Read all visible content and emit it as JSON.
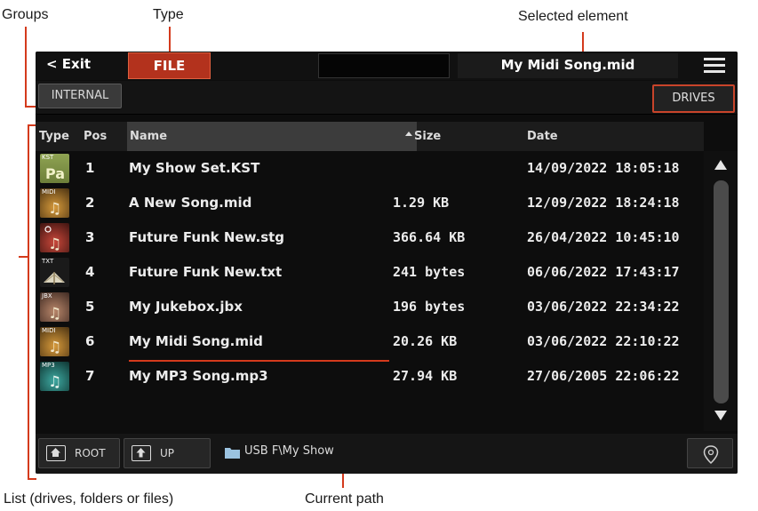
{
  "callouts": {
    "groups": "Groups",
    "type": "Type",
    "selected_element": "Selected element",
    "list": "List (drives, folders or files)",
    "current_path": "Current path"
  },
  "topbar": {
    "exit_label": "< Exit",
    "type_label": "FILE",
    "selected_element": "My Midi Song.mid",
    "menu_icon": "hamburger-icon"
  },
  "groups": {
    "internal_label": "INTERNAL",
    "drives_label": "DRIVES"
  },
  "table": {
    "headers": {
      "type": "Type",
      "pos": "Pos",
      "name": "Name",
      "size": "Size",
      "date": "Date"
    },
    "sort_column": "Name",
    "rows": [
      {
        "icon": "pa-set-icon",
        "icon_tag": "KST",
        "pos": "1",
        "name": "My Show Set.KST",
        "size": "",
        "date": "14/09/2022 18:05:18"
      },
      {
        "icon": "midi-file-icon",
        "icon_tag": "MIDI",
        "pos": "2",
        "name": "A New Song.mid",
        "size": "1.29 KB",
        "date": "12/09/2022 18:24:18"
      },
      {
        "icon": "style-file-icon",
        "icon_tag": "",
        "pos": "3",
        "name": "Future Funk New.stg",
        "size": "366.64 KB",
        "date": "26/04/2022 10:45:10"
      },
      {
        "icon": "txt-file-icon",
        "icon_tag": "TXT",
        "pos": "4",
        "name": "Future Funk New.txt",
        "size": "241 bytes",
        "date": "06/06/2022 17:43:17"
      },
      {
        "icon": "jukebox-file-icon",
        "icon_tag": "JBX",
        "pos": "5",
        "name": "My Jukebox.jbx",
        "size": "196 bytes",
        "date": "03/06/2022 22:34:22"
      },
      {
        "icon": "midi-file-icon",
        "icon_tag": "MIDI",
        "pos": "6",
        "name": "My Midi Song.mid",
        "size": "20.26 KB",
        "date": "03/06/2022 22:10:22"
      },
      {
        "icon": "mp3-file-icon",
        "icon_tag": "MP3",
        "pos": "7",
        "name": "My MP3 Song.mp3",
        "size": "27.94 KB",
        "date": "27/06/2005 22:06:22"
      }
    ]
  },
  "bottombar": {
    "root_label": "ROOT",
    "up_label": "UP",
    "current_path": "USB F\\My Show"
  },
  "colors": {
    "accent": "#d43a1c",
    "type_button": "#b3321d",
    "screen_bg": "#0d0d0d"
  }
}
